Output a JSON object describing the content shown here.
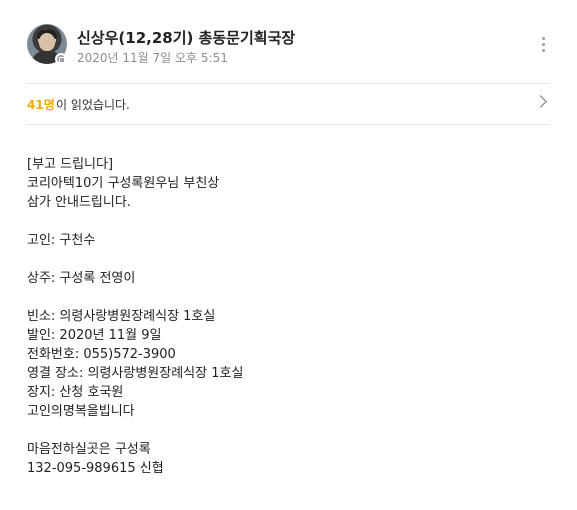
{
  "post": {
    "author_name": "신상우(12,28기) 총동문기획국장",
    "timestamp": "2020년 11월 7일 오후 5:51",
    "read_count": "41명",
    "read_text": "이 읽었습니다.",
    "more_icon": "more-vertical-icon",
    "chevron_icon": "chevron-right-icon"
  },
  "content": {
    "line1": "[부고 드립니다]",
    "line2": "코리아텍10기 구성록원우님 부친상",
    "line3": "삼가 안내드립니다.",
    "line4": "고인: 구천수",
    "line5": "상주: 구성록 전영이",
    "line6": "빈소: 의령사랑병원장례식장 1호실",
    "line7": "발인: 2020년 11월 9일",
    "line8": "전화번호: 055)572-3900",
    "line9": "영결 장소: 의령사랑병원장례식장 1호실",
    "line10": "장지: 산청 호국원",
    "line11": "고인의명복을빕니다",
    "line12": "마음전하실곳은  구성록",
    "line13": "132-095-989615 신협"
  },
  "colors": {
    "accent": "#f2a900",
    "secondary_text": "#8e8e8e",
    "divider": "#e7e7e7"
  }
}
